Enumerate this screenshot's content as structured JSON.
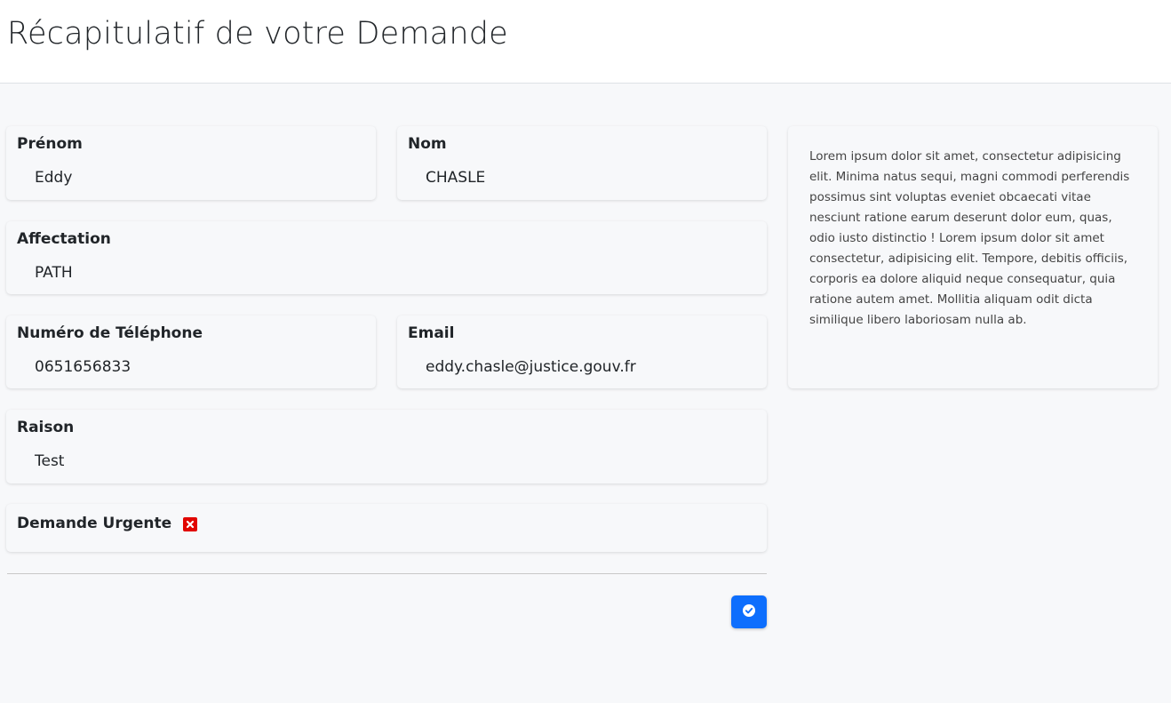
{
  "header": {
    "title": "Récapitulatif de votre Demande"
  },
  "fields": {
    "prenom": {
      "label": "Prénom",
      "value": "Eddy"
    },
    "nom": {
      "label": "Nom",
      "value": "CHASLE"
    },
    "affectation": {
      "label": "Affectation",
      "value": "PATH"
    },
    "telephone": {
      "label": "Numéro de Téléphone",
      "value": "0651656833"
    },
    "email": {
      "label": "Email",
      "value": "eddy.chasle@justice.gouv.fr"
    },
    "raison": {
      "label": "Raison",
      "value": "Test"
    },
    "urgent": {
      "label": "Demande Urgente",
      "checked": false,
      "icon": "x-square-icon",
      "color": "#e10600"
    }
  },
  "info": {
    "text": "Lorem ipsum dolor sit amet, consectetur adipisicing elit. Minima natus sequi, magni commodi perferendis possimus sint voluptas eveniet obcaecati vitae nesciunt ratione earum deserunt dolor eum, quas, odio iusto distinctio ! Lorem ipsum dolor sit amet consectetur, adipisicing elit. Tempore, debitis officiis, corporis ea dolore aliquid neque consequatur, quia ratione autem amet. Mollitia aliquam odit dicta similique libero laboriosam nulla ab."
  },
  "actions": {
    "confirm_icon": "check-circle-icon",
    "accent": "#0d6efd"
  }
}
